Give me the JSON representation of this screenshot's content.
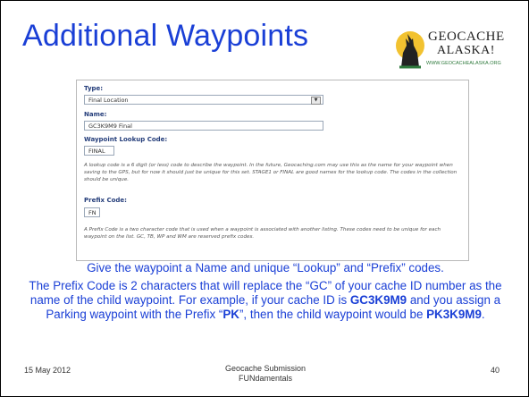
{
  "slide": {
    "title": "Additional Waypoints",
    "logo": {
      "name_line1": "GEOCACHE",
      "name_line2": "ALASKA!",
      "url": "WWW.GEOCACHEALASKA.ORG"
    },
    "form": {
      "type_label": "Type:",
      "type_value": "Final Location",
      "name_label": "Name:",
      "name_value": "GC3K9M9 Final",
      "lookup_label": "Waypoint Lookup Code:",
      "lookup_value": "FINAL",
      "lookup_help": "A lookup code is a 6 digit (or less) code to describe the waypoint. In the future, Geocaching.com may use this as the name for your waypoint when saving to the GPS, but for now it should just be unique for this set. STAGE1 or FINAL are good names for the lookup code. The codes in the collection should be unique.",
      "prefix_label": "Prefix Code:",
      "prefix_value": "FN",
      "prefix_help": "A Prefix Code is a two character code that is used when a waypoint is associated with another listing. These codes need to be unique for each waypoint on the list. GC, TB, WP and WM are reserved prefix codes."
    },
    "caption": "Give the waypoint a Name and unique “Lookup” and “Prefix” codes.",
    "paragraph": {
      "part1": "The Prefix Code is 2 characters that will replace the “GC” of your cache ID number as the name of the child waypoint.  For example, if your cache ID is ",
      "cache_id": "GC3K9M9",
      "part2": " and you assign a Parking waypoint with the Prefix “",
      "prefix": "PK",
      "part3": "”, then the child waypoint would be ",
      "child_id": "PK3K9M9",
      "part4": "."
    },
    "footer": {
      "date": "15 May 2012",
      "center_line1": "Geocache Submission",
      "center_line2": "FUNdamentals",
      "page_number": "40"
    }
  }
}
